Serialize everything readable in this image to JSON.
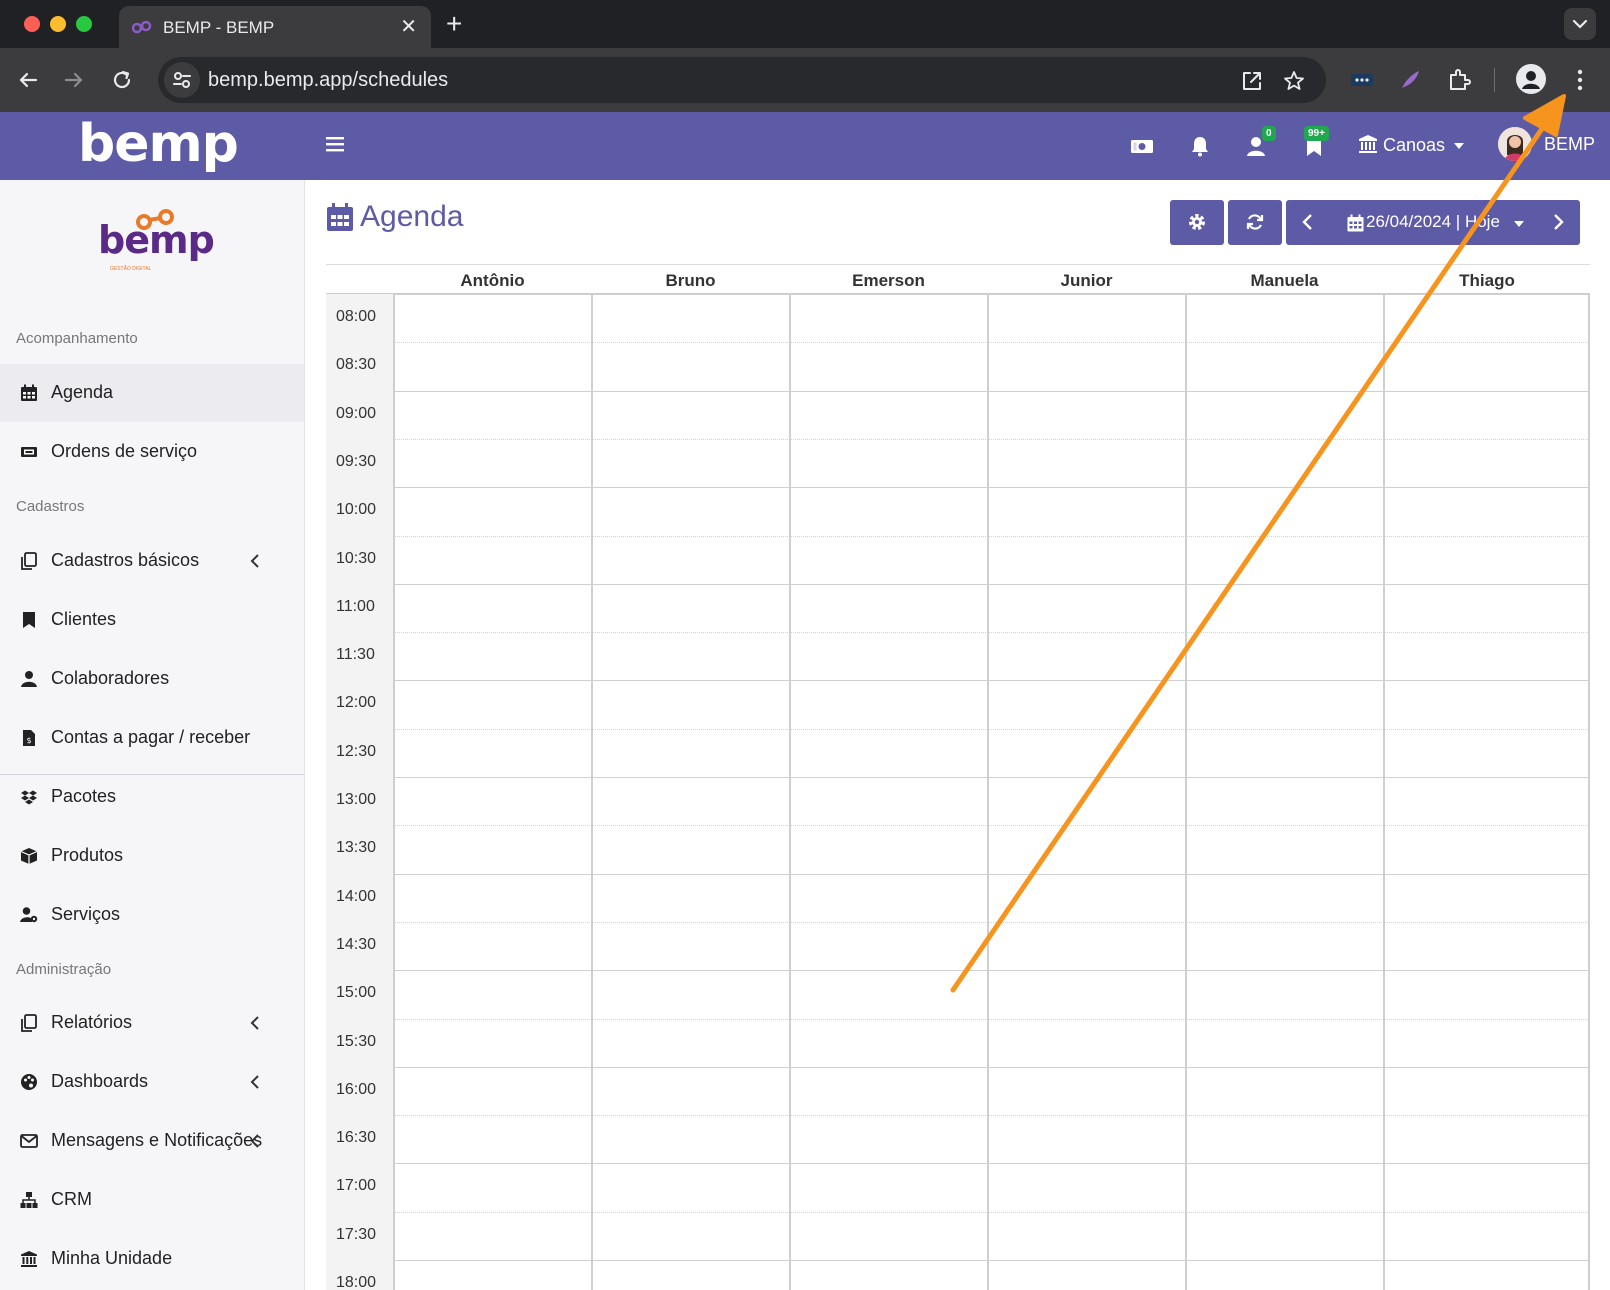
{
  "browser": {
    "tab_title": "BEMP - BEMP",
    "tab_close": "✕",
    "new_tab": "+",
    "url": "bemp.bemp.app/schedules"
  },
  "header": {
    "brand": "bemp",
    "badges": {
      "contacts": "0",
      "bookmarks": "99+"
    },
    "unit": "Canoas",
    "user": "BEMP"
  },
  "sidebar": {
    "logo_text": "bemp",
    "logo_sub": "GESTÃO DIGITAL",
    "sections": [
      "Acompanhamento",
      "Cadastros",
      "Administração"
    ],
    "items": [
      {
        "label": "Agenda",
        "icon": "calendar-icon"
      },
      {
        "label": "Ordens de serviço",
        "icon": "ticket-icon"
      },
      {
        "label": "Cadastros básicos",
        "icon": "copy-icon"
      },
      {
        "label": "Clientes",
        "icon": "bookmark-icon"
      },
      {
        "label": "Colaboradores",
        "icon": "user-icon"
      },
      {
        "label": "Contas a pagar / receber",
        "icon": "invoice-icon"
      },
      {
        "label": "Pacotes",
        "icon": "dropbox-icon"
      },
      {
        "label": "Produtos",
        "icon": "cube-icon"
      },
      {
        "label": "Serviços",
        "icon": "user-cog-icon"
      },
      {
        "label": "Relatórios",
        "icon": "copy-icon"
      },
      {
        "label": "Dashboards",
        "icon": "palette-icon"
      },
      {
        "label": "Mensagens e Notificações",
        "icon": "envelope-icon"
      },
      {
        "label": "CRM",
        "icon": "sitemap-icon"
      },
      {
        "label": "Minha Unidade",
        "icon": "bank-icon"
      }
    ]
  },
  "page": {
    "title": "Agenda",
    "date": "26/04/2024 | Hoje"
  },
  "schedule": {
    "professionals": [
      "Antônio",
      "Bruno",
      "Emerson",
      "Junior",
      "Manuela",
      "Thiago"
    ],
    "times": [
      "08:00",
      "08:30",
      "09:00",
      "09:30",
      "10:00",
      "10:30",
      "11:00",
      "11:30",
      "12:00",
      "12:30",
      "13:00",
      "13:30",
      "14:00",
      "14:30",
      "15:00",
      "15:30",
      "16:00",
      "16:30",
      "17:00",
      "17:30",
      "18:00"
    ]
  },
  "colors": {
    "brand_purple": "#5e5ba6",
    "annotation_arrow": "#f7941d",
    "badge_green": "#1fa84f"
  }
}
